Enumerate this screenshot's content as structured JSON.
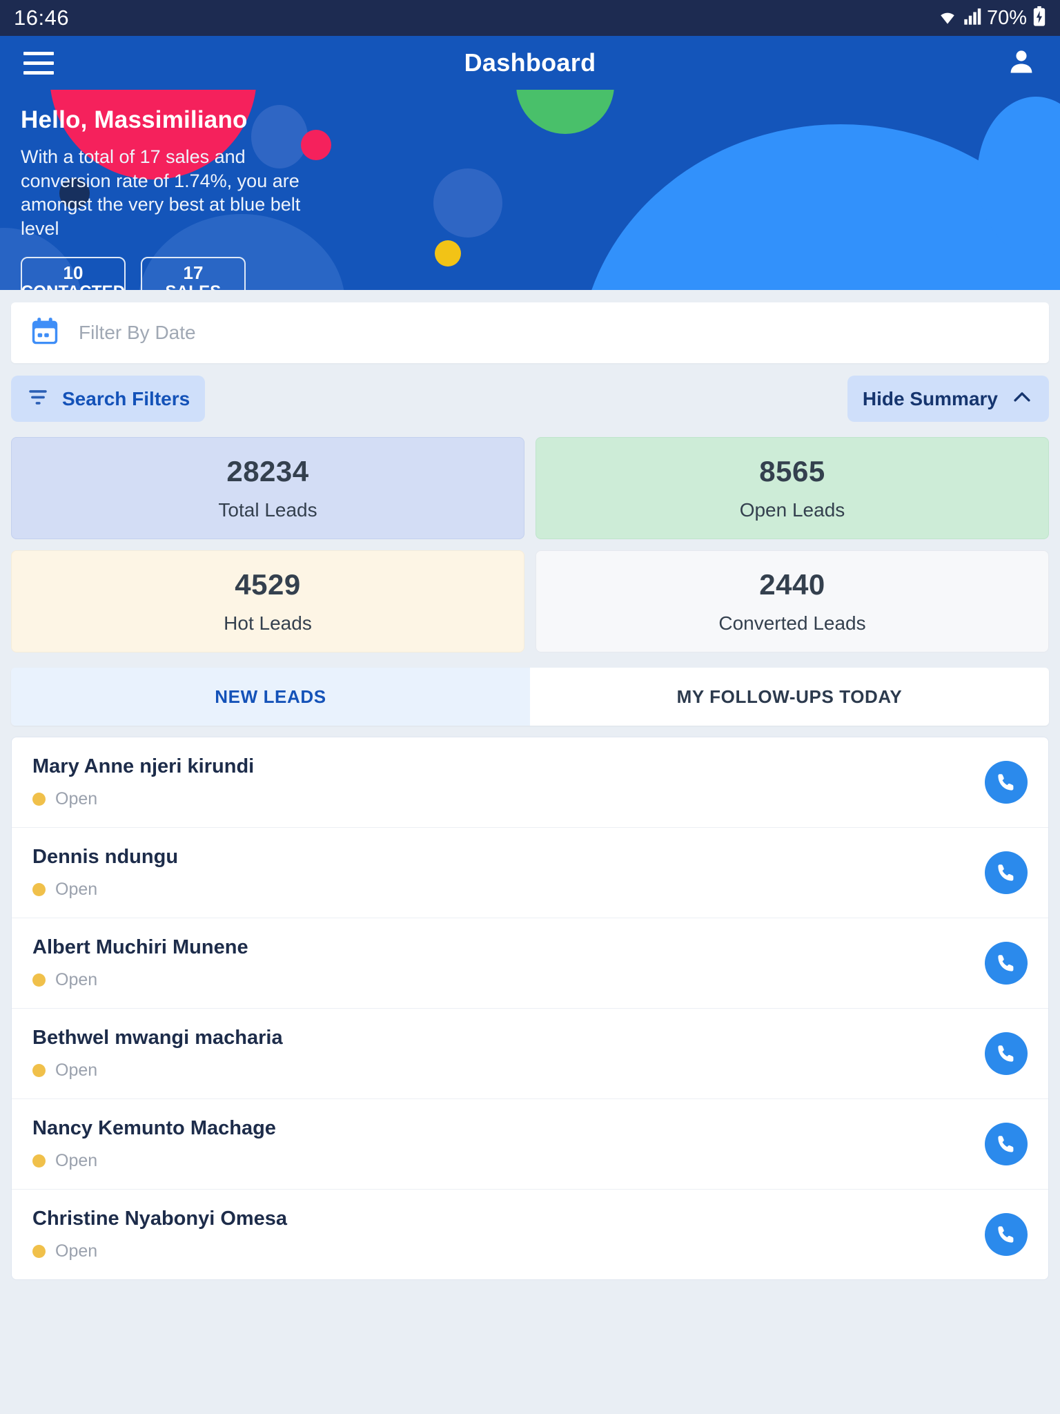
{
  "statusbar": {
    "time": "16:46",
    "battery": "70%",
    "wifi_icon": "wifi-icon",
    "signal_icon": "cellular-signal-icon",
    "battery_icon": "battery-charging-icon"
  },
  "appbar": {
    "title": "Dashboard",
    "menu_icon": "hamburger-menu-icon",
    "profile_icon": "person-avatar-icon"
  },
  "hero": {
    "greeting": "Hello, Massimiliano",
    "subtitle": "With a total of 17 sales and conversion rate of 1.74%, you are amongst the very best at blue belt level",
    "pills": [
      {
        "value": "10",
        "label": "CONTACTED"
      },
      {
        "value": "17",
        "label": "SALES"
      }
    ],
    "colors": {
      "background": "#1455ba",
      "pink": "#f5215c",
      "green": "#49c06a",
      "light_blue": "#3291fb",
      "yellow": "#f2c316",
      "dark_navy": "#17305e"
    }
  },
  "filters": {
    "date_placeholder": "Filter By Date",
    "calendar_icon": "calendar-icon",
    "search_filters_label": "Search Filters",
    "search_filters_icon": "filter-icon",
    "hide_summary_label": "Hide Summary",
    "hide_summary_icon": "chevron-up-icon"
  },
  "summary_cards": [
    {
      "value": "28234",
      "label": "Total Leads",
      "color": "#d3ddf5"
    },
    {
      "value": "8565",
      "label": "Open Leads",
      "color": "#cdecd7"
    },
    {
      "value": "4529",
      "label": "Hot Leads",
      "color": "#fdf5e5"
    },
    {
      "value": "2440",
      "label": "Converted Leads",
      "color": "#f7f8fa"
    }
  ],
  "tabs": [
    {
      "label": "NEW LEADS",
      "active": true
    },
    {
      "label": "MY FOLLOW-UPS TODAY",
      "active": false
    }
  ],
  "leads": [
    {
      "name": "Mary Anne njeri kirundi",
      "status": "Open",
      "status_color": "#f0c04a",
      "action_icon": "phone-call-icon"
    },
    {
      "name": "Dennis ndungu",
      "status": "Open",
      "status_color": "#f0c04a",
      "action_icon": "phone-call-icon"
    },
    {
      "name": "Albert Muchiri Munene",
      "status": "Open",
      "status_color": "#f0c04a",
      "action_icon": "phone-call-icon"
    },
    {
      "name": "Bethwel mwangi macharia",
      "status": "Open",
      "status_color": "#f0c04a",
      "action_icon": "phone-call-icon"
    },
    {
      "name": "Nancy Kemunto Machage",
      "status": "Open",
      "status_color": "#f0c04a",
      "action_icon": "phone-call-icon"
    },
    {
      "name": "Christine Nyabonyi Omesa",
      "status": "Open",
      "status_color": "#f0c04a",
      "action_icon": "phone-call-icon"
    }
  ]
}
